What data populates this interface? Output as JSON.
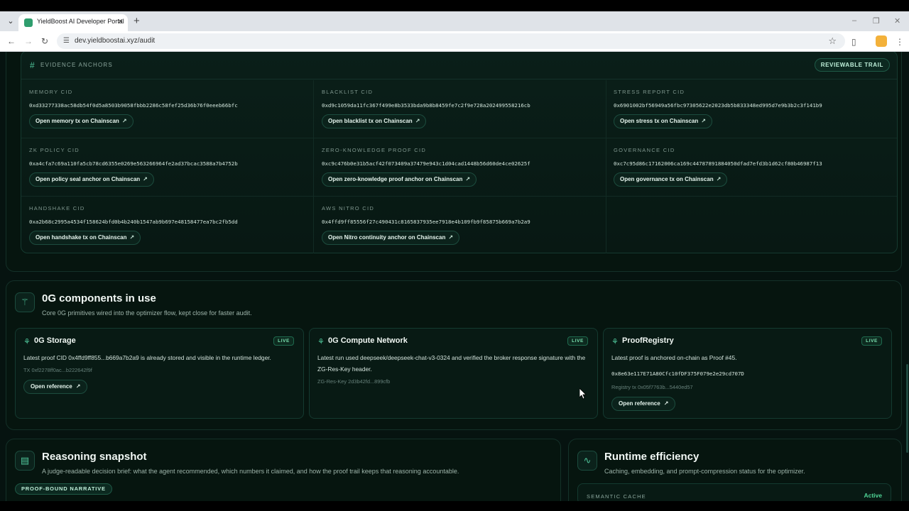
{
  "browser": {
    "tab_title": "YieldBoost AI Developer Portal",
    "url": "dev.yieldboostai.xyz/audit"
  },
  "anchors": {
    "title": "EVIDENCE ANCHORS",
    "badge": "REVIEWABLE TRAIL",
    "cells": [
      {
        "label": "MEMORY CID",
        "cid": "0xd33277338ac58db54f0d5a8503b9058fbbb2286c58fef25d36b76f0eeeb66bfc",
        "link": "Open memory tx on Chainscan"
      },
      {
        "label": "BLACKLIST CID",
        "cid": "0xd9c1059da11fc367f499e8b3533bda9b8b8459fe7c2f9e728a202499558216cb",
        "link": "Open blacklist tx on Chainscan"
      },
      {
        "label": "STRESS REPORT CID",
        "cid": "0x6901002bf56949a56fbc97305622e2023db5b833348ed995d7e9b3b2c3f141b9",
        "link": "Open stress tx on Chainscan"
      },
      {
        "label": "ZK POLICY CID",
        "cid": "0xa4cfa7c69a110fa5cb78cd6355e0269e563266964fe2ad37bcac3588a7b4752b",
        "link": "Open policy seal anchor on Chainscan"
      },
      {
        "label": "ZERO-KNOWLEDGE PROOF CID",
        "cid": "0xc9c476b0e31b5acf42f073409a37479e943c1d04cad1448b56d60de4ce02625f",
        "link": "Open zero-knowledge proof anchor on Chainscan"
      },
      {
        "label": "GOVERNANCE CID",
        "cid": "0xc7c95d86c17162006ca169c44787891884050dfad7efd3b1d62cf80b46987f13",
        "link": "Open governance tx on Chainscan"
      },
      {
        "label": "HANDSHAKE CID",
        "cid": "0xa2b68c2995a4534f158624bfd0b4b240b1547ab9b697e48158477ea7bc2fb5dd",
        "link": "Open handshake tx on Chainscan"
      },
      {
        "label": "AWS NITRO CID",
        "cid": "0x4ffd9ff85556f27c490431c8165837935ee7918e4b109fb9f85875b669a7b2a9",
        "link": "Open Nitro continuity anchor on Chainscan"
      }
    ]
  },
  "components": {
    "title": "0G components in use",
    "subtitle": "Core 0G primitives wired into the optimizer flow, kept close for faster audit.",
    "cards": [
      {
        "name": "0G Storage",
        "status": "LIVE",
        "desc": "Latest proof CID 0x4ffd9ff855...b669a7b2a9 is already stored and visible in the runtime ledger.",
        "meta": "TX 0xf2278ff0ac...b222642f9f",
        "button": "Open reference"
      },
      {
        "name": "0G Compute Network",
        "status": "LIVE",
        "desc": "Latest run used deepseek/deepseek-chat-v3-0324 and verified the broker response signature with the ZG-Res-Key header.",
        "meta": "ZG-Res-Key 2d3b42fd...899cfb"
      },
      {
        "name": "ProofRegistry",
        "status": "LIVE",
        "desc": "Latest proof is anchored on-chain as Proof #45.",
        "hash": "0x8e63e117E71A80Cfc10fDF375F079e2e29cd707D",
        "meta": "Registry tx 0x05f7763b...5440ed57",
        "button": "Open reference"
      }
    ]
  },
  "reasoning": {
    "title": "Reasoning snapshot",
    "subtitle": "A judge-readable decision brief: what the agent recommended, which numbers it claimed, and how the proof trail keeps that reasoning accountable.",
    "badge": "PROOF-BOUND NARRATIVE"
  },
  "runtime": {
    "title": "Runtime efficiency",
    "subtitle": "Caching, embedding, and prompt-compression status for the optimizer.",
    "cache_label": "SEMANTIC CACHE",
    "cache_status": "Active"
  },
  "colors": {
    "accent": "#4fc59a",
    "background": "#061310",
    "live_badge": "#7be3b1"
  }
}
